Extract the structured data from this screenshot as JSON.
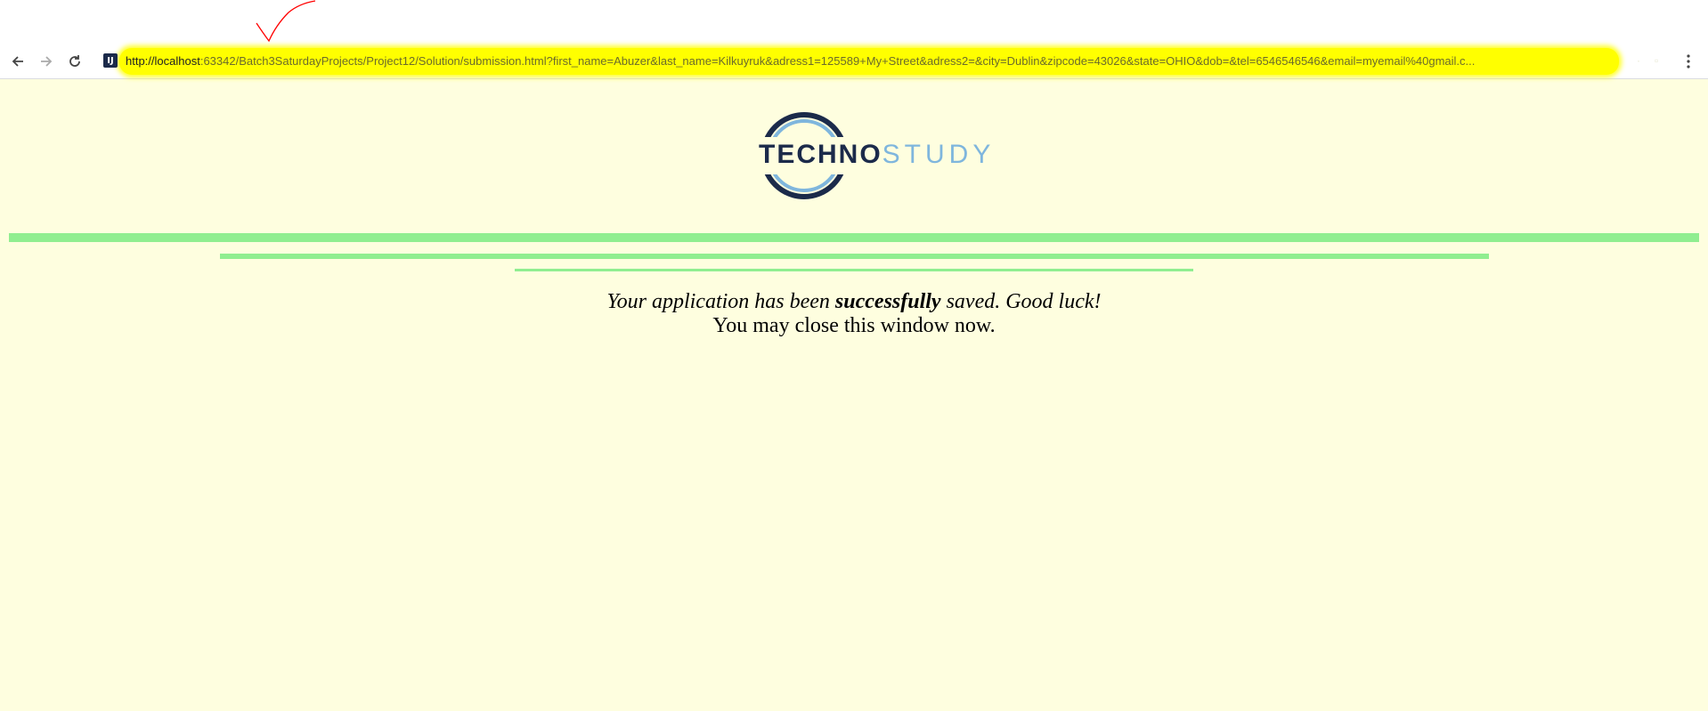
{
  "browser": {
    "url_host": "http://localhost",
    "url_rest": ":63342/Batch3SaturdayProjects/Project12/Solution/submission.html?first_name=Abuzer&last_name=Kilkuyruk&adress1=125589+My+Street&adress2=&city=Dublin&zipcode=43026&state=OHIO&dob=&tel=6546546546&email=myemail%40gmail.c...",
    "icons": {
      "back": "back-arrow-icon",
      "forward": "forward-arrow-icon",
      "reload": "reload-icon",
      "site": "site-favicon",
      "menu": "more-vertical-icon"
    },
    "highlight_color": "#ffff00",
    "annotation_color": "#ff0000"
  },
  "logo": {
    "part1": "TECHNO",
    "part2": "STUDY",
    "colors": {
      "dark": "#1b2a4a",
      "light": "#7fb6dd"
    }
  },
  "message": {
    "line1_before": "Your application has been ",
    "line1_bold": "successfully",
    "line1_after": " saved. Good luck!",
    "line2": "You may close this window now."
  },
  "colors": {
    "background": "#fefedf",
    "divider": "#90ee90"
  }
}
